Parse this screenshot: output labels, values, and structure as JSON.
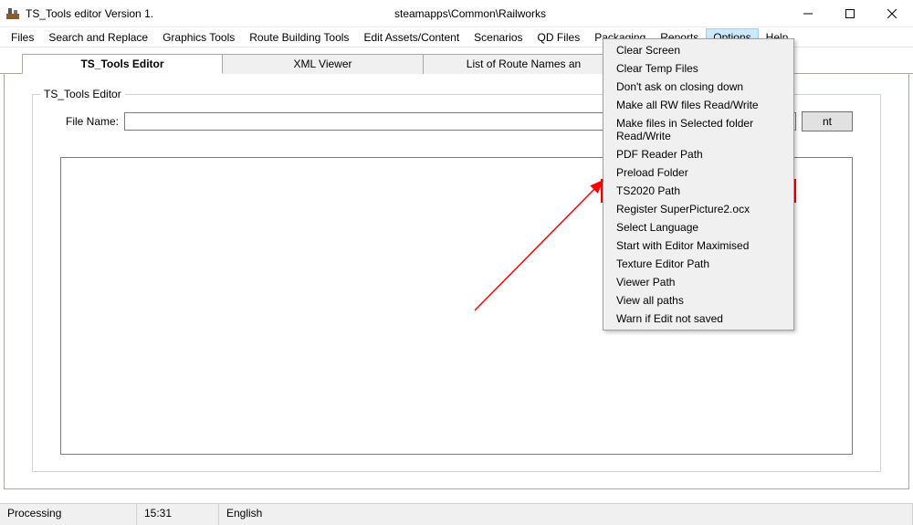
{
  "titlebar": {
    "left": "TS_Tools editor  Version 1.",
    "center": "steamapps\\Common\\Railworks"
  },
  "menubar": {
    "items": [
      "Files",
      "Search and Replace",
      "Graphics Tools",
      "Route Building Tools",
      "Edit Assets/Content",
      "Scenarios",
      "QD Files",
      "Packaging",
      "Reports",
      "Options",
      "Help"
    ],
    "active_index": 9
  },
  "tabs": {
    "items": [
      "TS_Tools Editor",
      "XML Viewer",
      "List of Route Names an"
    ],
    "active_index": 0
  },
  "groupbox": {
    "legend": "TS_Tools Editor",
    "file_label": "File Name:",
    "file_value": "",
    "button_label_partial": "nt"
  },
  "dropdown": {
    "items": [
      "Clear Screen",
      "Clear Temp Files",
      "Don't ask on closing down",
      "Make all RW files Read/Write",
      "Make files in Selected folder Read/Write",
      "PDF Reader Path",
      "Preload Folder",
      "TS2020 Path",
      "Register SuperPicture2.ocx",
      "Select Language",
      "Start with Editor Maximised",
      "Texture Editor Path",
      "Viewer Path",
      "View all paths",
      "Warn if Edit not saved"
    ],
    "highlighted_index": 7
  },
  "statusbar": {
    "cell1": "Processing",
    "cell2": "15:31",
    "cell3": "English"
  }
}
